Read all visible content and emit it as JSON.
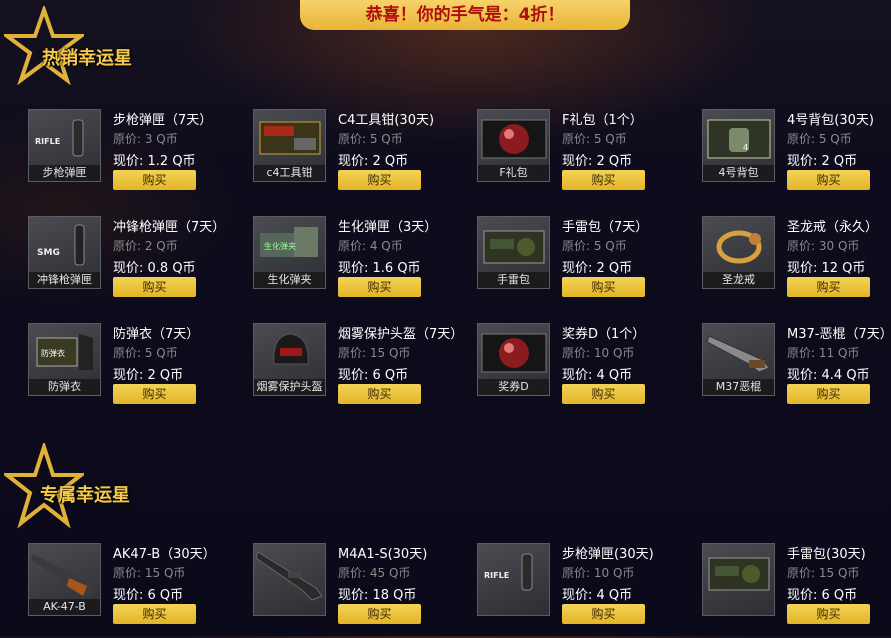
{
  "banner": "恭喜！你的手气是：4折！",
  "sections": [
    {
      "title": "热销幸运星",
      "items": [
        {
          "name": "步枪弹匣（7天）",
          "orig": "原价: 3 Q币",
          "now": "现价: 1.2 Q币",
          "cap": "步枪弹匣",
          "icon": "rifle-magazine-icon",
          "buy": "购买"
        },
        {
          "name": "C4工具钳(30天)",
          "orig": "原价: 5 Q币",
          "now": "现价: 2 Q币",
          "cap": "c4工具钳",
          "icon": "c4-pliers-icon",
          "buy": "购买"
        },
        {
          "name": "F礼包（1个）",
          "orig": "原价: 5 Q币",
          "now": "现价: 2 Q币",
          "cap": "F礼包",
          "icon": "red-orb-icon",
          "buy": "购买"
        },
        {
          "name": "4号背包(30天)",
          "orig": "原价: 5 Q币",
          "now": "现价: 2 Q币",
          "cap": "4号背包",
          "icon": "backpack-icon",
          "buy": "购买"
        },
        {
          "name": "冲锋枪弹匣（7天）",
          "orig": "原价: 2 Q币",
          "now": "现价: 0.8 Q币",
          "cap": "冲锋枪弹匣",
          "icon": "smg-magazine-icon",
          "buy": "购买"
        },
        {
          "name": "生化弹匣（3天）",
          "orig": "原价: 4 Q币",
          "now": "现价: 1.6 Q币",
          "cap": "生化弹夹",
          "icon": "bio-clip-icon",
          "buy": "购买"
        },
        {
          "name": "手雷包（7天）",
          "orig": "原价: 5 Q币",
          "now": "现价: 2 Q币",
          "cap": "手雷包",
          "icon": "grenade-pack-icon",
          "buy": "购买"
        },
        {
          "name": "圣龙戒（永久）",
          "orig": "原价: 30 Q币",
          "now": "现价: 12 Q币",
          "cap": "圣龙戒",
          "icon": "dragon-ring-icon",
          "buy": "购买"
        },
        {
          "name": "防弹衣（7天）",
          "orig": "原价: 5 Q币",
          "now": "现价: 2 Q币",
          "cap": "防弹衣",
          "icon": "armor-icon",
          "buy": "购买"
        },
        {
          "name": "烟雾保护头盔（7天）",
          "orig": "原价: 15 Q币",
          "now": "现价: 6 Q币",
          "cap": "烟雾保护头盔",
          "icon": "helmet-icon",
          "buy": "购买"
        },
        {
          "name": "奖券D（1个）",
          "orig": "原价: 10 Q币",
          "now": "现价: 4 Q币",
          "cap": "奖券D",
          "icon": "red-orb-icon",
          "buy": "购买"
        },
        {
          "name": "M37-恶棍（7天）",
          "orig": "原价: 11 Q币",
          "now": "现价: 4.4 Q币",
          "cap": "M37恶棍",
          "icon": "shotgun-icon",
          "buy": "购买"
        }
      ]
    },
    {
      "title": "专属幸运星",
      "items": [
        {
          "name": "AK47-B（30天）",
          "orig": "原价: 15 Q币",
          "now": "现价: 6 Q币",
          "cap": "AK-47-B",
          "icon": "ak47-icon",
          "buy": "购买"
        },
        {
          "name": "M4A1-S(30天)",
          "orig": "原价: 45 Q币",
          "now": "现价: 18 Q币",
          "cap": "",
          "icon": "m4a1-icon",
          "buy": "购买"
        },
        {
          "name": "步枪弹匣(30天)",
          "orig": "原价: 10 Q币",
          "now": "现价: 4 Q币",
          "cap": "",
          "icon": "rifle-magazine-icon",
          "buy": "购买"
        },
        {
          "name": "手雷包(30天)",
          "orig": "原价: 15 Q币",
          "now": "现价: 6 Q币",
          "cap": "",
          "icon": "grenade-pack-icon",
          "buy": "购买"
        }
      ]
    }
  ],
  "colors": {
    "accent": "#f3d355",
    "price_old": "#8a8a8a",
    "banner_text": "#b00d0d",
    "title": "#f5c94a"
  }
}
